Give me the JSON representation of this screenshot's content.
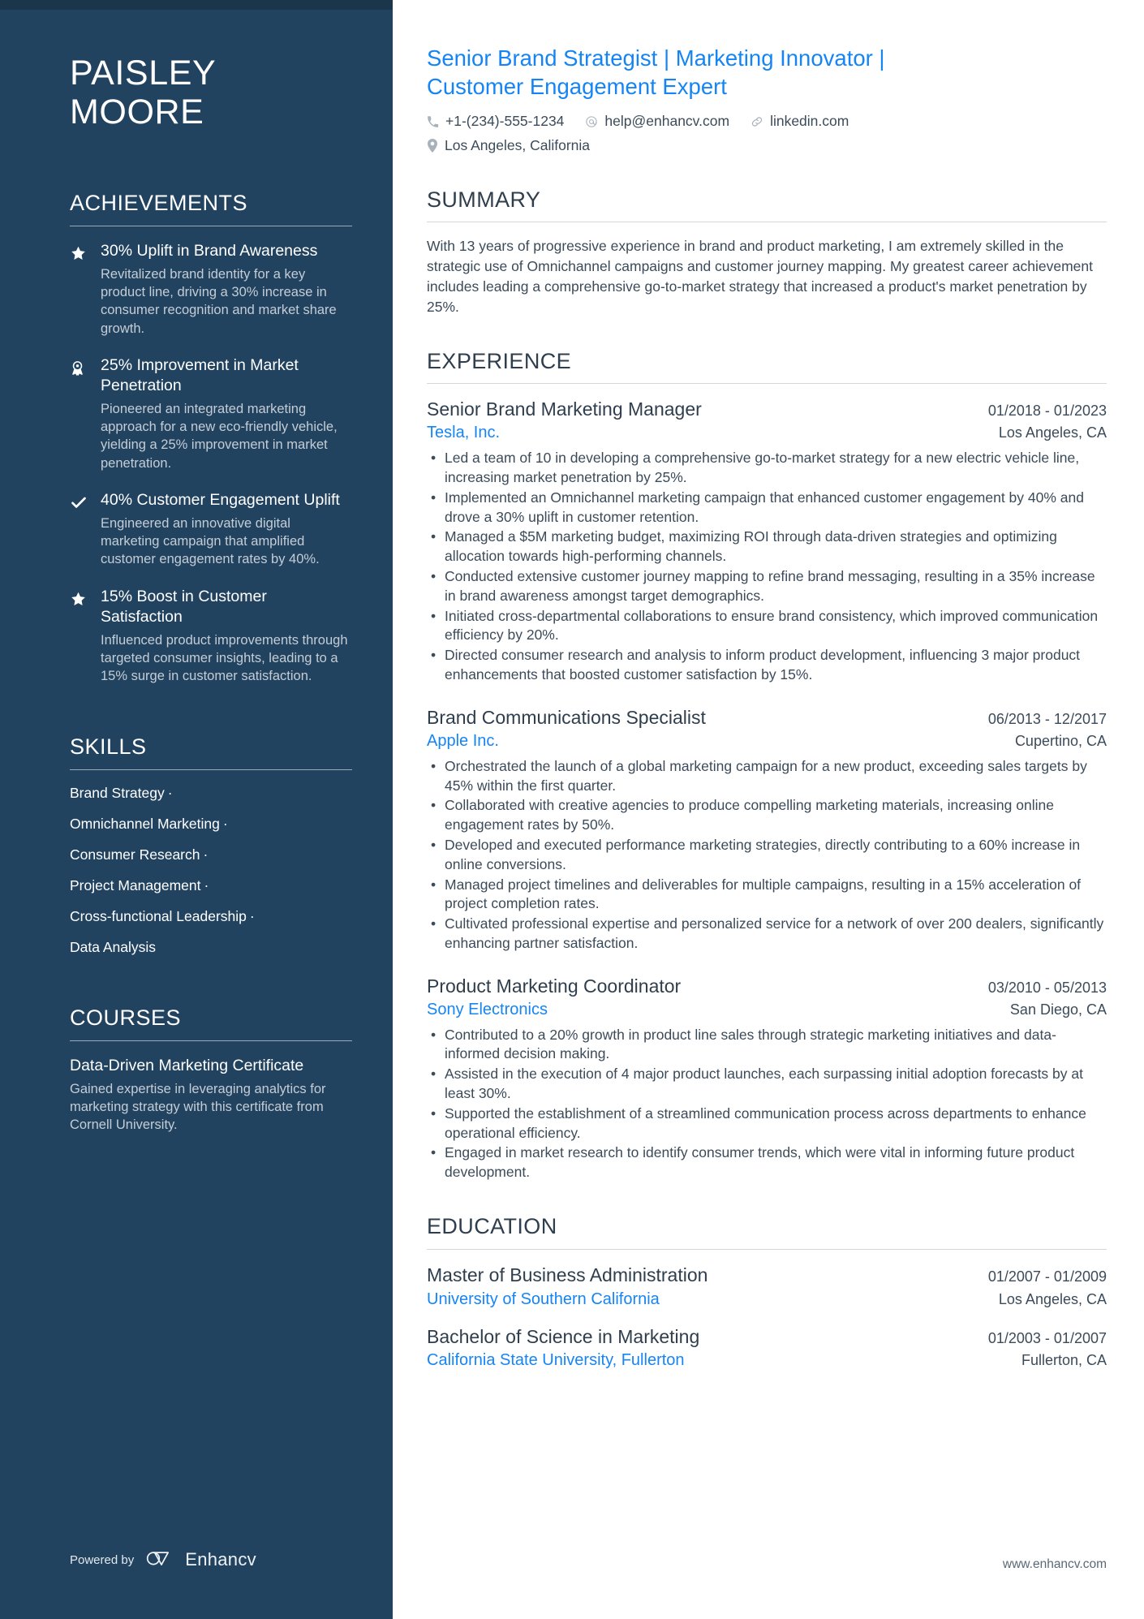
{
  "sidebar": {
    "name_line1": "PAISLEY",
    "name_line2": "MOORE",
    "achievements": {
      "heading": "ACHIEVEMENTS",
      "items": [
        {
          "icon": "star-icon",
          "title": "30% Uplift in Brand Awareness",
          "desc": "Revitalized brand identity for a key product line, driving a 30% increase in consumer recognition and market share growth."
        },
        {
          "icon": "award-ribbon-icon",
          "title": "25% Improvement in Market Penetration",
          "desc": "Pioneered an integrated marketing approach for a new eco-friendly vehicle, yielding a 25% improvement in market penetration."
        },
        {
          "icon": "check-icon",
          "title": "40% Customer Engagement Uplift",
          "desc": "Engineered an innovative digital marketing campaign that amplified customer engagement rates by 40%."
        },
        {
          "icon": "star-icon",
          "title": "15% Boost in Customer Satisfaction",
          "desc": "Influenced product improvements through targeted consumer insights, leading to a 15% surge in customer satisfaction."
        }
      ]
    },
    "skills": {
      "heading": "SKILLS",
      "items": [
        {
          "label": "Brand Strategy",
          "sep": "·"
        },
        {
          "label": "Omnichannel Marketing",
          "sep": "·"
        },
        {
          "label": "Consumer Research",
          "sep": "·"
        },
        {
          "label": "Project Management",
          "sep": "·"
        },
        {
          "label": "Cross-functional Leadership",
          "sep": "·"
        },
        {
          "label": "Data Analysis",
          "sep": ""
        }
      ]
    },
    "courses": {
      "heading": "COURSES",
      "items": [
        {
          "title": "Data-Driven Marketing Certificate",
          "desc": "Gained expertise in leveraging analytics for marketing strategy with this certificate from Cornell University."
        }
      ]
    },
    "footer": {
      "powered_by": "Powered by",
      "brand": "Enhancv"
    }
  },
  "main": {
    "headline": "Senior Brand Strategist | Marketing Innovator | Customer Engagement Expert",
    "contacts": [
      {
        "icon": "phone-icon",
        "value": "+1-(234)-555-1234"
      },
      {
        "icon": "at-email-icon",
        "value": "help@enhancv.com"
      },
      {
        "icon": "link-icon",
        "value": "linkedin.com"
      },
      {
        "icon": "location-pin-icon",
        "value": "Los Angeles, California"
      }
    ],
    "summary": {
      "heading": "SUMMARY",
      "text": "With 13 years of progressive experience in brand and product marketing, I am extremely skilled in the strategic use of Omnichannel campaigns and customer journey mapping. My greatest career achievement includes leading a comprehensive go-to-market strategy that increased a product's market penetration by 25%."
    },
    "experience": {
      "heading": "EXPERIENCE",
      "jobs": [
        {
          "title": "Senior Brand Marketing Manager",
          "date": "01/2018 - 01/2023",
          "company": "Tesla, Inc.",
          "location": "Los Angeles, CA",
          "bullets": [
            "Led a team of 10 in developing a comprehensive go-to-market strategy for a new electric vehicle line, increasing market penetration by 25%.",
            "Implemented an Omnichannel marketing campaign that enhanced customer engagement by 40% and drove a 30% uplift in customer retention.",
            "Managed a $5M marketing budget, maximizing ROI through data-driven strategies and optimizing allocation towards high-performing channels.",
            "Conducted extensive customer journey mapping to refine brand messaging, resulting in a 35% increase in brand awareness amongst target demographics.",
            "Initiated cross-departmental collaborations to ensure brand consistency, which improved communication efficiency by 20%.",
            "Directed consumer research and analysis to inform product development, influencing 3 major product enhancements that boosted customer satisfaction by 15%."
          ]
        },
        {
          "title": "Brand Communications Specialist",
          "date": "06/2013 - 12/2017",
          "company": "Apple Inc.",
          "location": "Cupertino, CA",
          "bullets": [
            "Orchestrated the launch of a global marketing campaign for a new product, exceeding sales targets by 45% within the first quarter.",
            "Collaborated with creative agencies to produce compelling marketing materials, increasing online engagement rates by 50%.",
            "Developed and executed performance marketing strategies, directly contributing to a 60% increase in online conversions.",
            "Managed project timelines and deliverables for multiple campaigns, resulting in a 15% acceleration of project completion rates.",
            "Cultivated professional expertise and personalized service for a network of over 200 dealers, significantly enhancing partner satisfaction."
          ]
        },
        {
          "title": "Product Marketing Coordinator",
          "date": "03/2010 - 05/2013",
          "company": "Sony Electronics",
          "location": "San Diego, CA",
          "bullets": [
            "Contributed to a 20% growth in product line sales through strategic marketing initiatives and data-informed decision making.",
            "Assisted in the execution of 4 major product launches, each surpassing initial adoption forecasts by at least 30%.",
            "Supported the establishment of a streamlined communication process across departments to enhance operational efficiency.",
            "Engaged in market research to identify consumer trends, which were vital in informing future product development."
          ]
        }
      ]
    },
    "education": {
      "heading": "EDUCATION",
      "items": [
        {
          "degree": "Master of Business Administration",
          "date": "01/2007 - 01/2009",
          "school": "University of Southern California",
          "location": "Los Angeles, CA"
        },
        {
          "degree": "Bachelor of Science in Marketing",
          "date": "01/2003 - 01/2007",
          "school": "California State University, Fullerton",
          "location": "Fullerton, CA"
        }
      ]
    },
    "footer_site": "www.enhancv.com"
  },
  "colors": {
    "sidebar_bg": "#22435f",
    "accent_blue": "#1585f5",
    "body_text": "#3c4b5a",
    "heading_text": "#2f3e4d"
  }
}
